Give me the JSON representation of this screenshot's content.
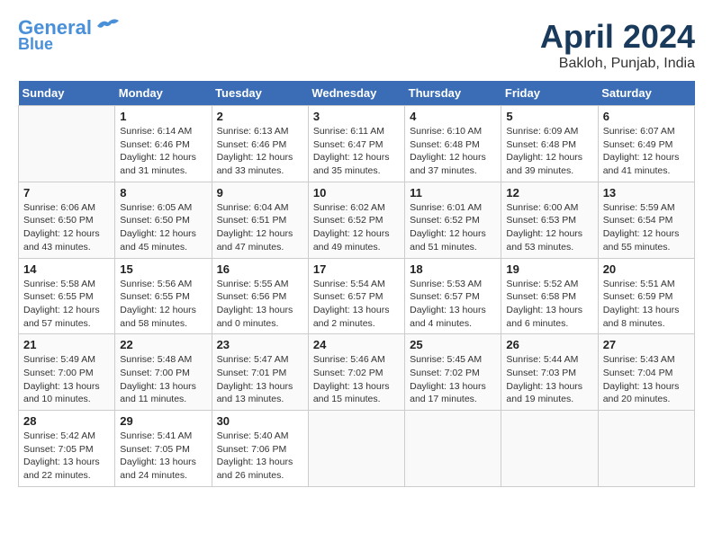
{
  "header": {
    "logo_line1": "General",
    "logo_line2": "Blue",
    "month_title": "April 2024",
    "location": "Bakloh, Punjab, India"
  },
  "weekdays": [
    "Sunday",
    "Monday",
    "Tuesday",
    "Wednesday",
    "Thursday",
    "Friday",
    "Saturday"
  ],
  "weeks": [
    [
      {
        "day": "",
        "info": ""
      },
      {
        "day": "1",
        "info": "Sunrise: 6:14 AM\nSunset: 6:46 PM\nDaylight: 12 hours\nand 31 minutes."
      },
      {
        "day": "2",
        "info": "Sunrise: 6:13 AM\nSunset: 6:46 PM\nDaylight: 12 hours\nand 33 minutes."
      },
      {
        "day": "3",
        "info": "Sunrise: 6:11 AM\nSunset: 6:47 PM\nDaylight: 12 hours\nand 35 minutes."
      },
      {
        "day": "4",
        "info": "Sunrise: 6:10 AM\nSunset: 6:48 PM\nDaylight: 12 hours\nand 37 minutes."
      },
      {
        "day": "5",
        "info": "Sunrise: 6:09 AM\nSunset: 6:48 PM\nDaylight: 12 hours\nand 39 minutes."
      },
      {
        "day": "6",
        "info": "Sunrise: 6:07 AM\nSunset: 6:49 PM\nDaylight: 12 hours\nand 41 minutes."
      }
    ],
    [
      {
        "day": "7",
        "info": "Sunrise: 6:06 AM\nSunset: 6:50 PM\nDaylight: 12 hours\nand 43 minutes."
      },
      {
        "day": "8",
        "info": "Sunrise: 6:05 AM\nSunset: 6:50 PM\nDaylight: 12 hours\nand 45 minutes."
      },
      {
        "day": "9",
        "info": "Sunrise: 6:04 AM\nSunset: 6:51 PM\nDaylight: 12 hours\nand 47 minutes."
      },
      {
        "day": "10",
        "info": "Sunrise: 6:02 AM\nSunset: 6:52 PM\nDaylight: 12 hours\nand 49 minutes."
      },
      {
        "day": "11",
        "info": "Sunrise: 6:01 AM\nSunset: 6:52 PM\nDaylight: 12 hours\nand 51 minutes."
      },
      {
        "day": "12",
        "info": "Sunrise: 6:00 AM\nSunset: 6:53 PM\nDaylight: 12 hours\nand 53 minutes."
      },
      {
        "day": "13",
        "info": "Sunrise: 5:59 AM\nSunset: 6:54 PM\nDaylight: 12 hours\nand 55 minutes."
      }
    ],
    [
      {
        "day": "14",
        "info": "Sunrise: 5:58 AM\nSunset: 6:55 PM\nDaylight: 12 hours\nand 57 minutes."
      },
      {
        "day": "15",
        "info": "Sunrise: 5:56 AM\nSunset: 6:55 PM\nDaylight: 12 hours\nand 58 minutes."
      },
      {
        "day": "16",
        "info": "Sunrise: 5:55 AM\nSunset: 6:56 PM\nDaylight: 13 hours\nand 0 minutes."
      },
      {
        "day": "17",
        "info": "Sunrise: 5:54 AM\nSunset: 6:57 PM\nDaylight: 13 hours\nand 2 minutes."
      },
      {
        "day": "18",
        "info": "Sunrise: 5:53 AM\nSunset: 6:57 PM\nDaylight: 13 hours\nand 4 minutes."
      },
      {
        "day": "19",
        "info": "Sunrise: 5:52 AM\nSunset: 6:58 PM\nDaylight: 13 hours\nand 6 minutes."
      },
      {
        "day": "20",
        "info": "Sunrise: 5:51 AM\nSunset: 6:59 PM\nDaylight: 13 hours\nand 8 minutes."
      }
    ],
    [
      {
        "day": "21",
        "info": "Sunrise: 5:49 AM\nSunset: 7:00 PM\nDaylight: 13 hours\nand 10 minutes."
      },
      {
        "day": "22",
        "info": "Sunrise: 5:48 AM\nSunset: 7:00 PM\nDaylight: 13 hours\nand 11 minutes."
      },
      {
        "day": "23",
        "info": "Sunrise: 5:47 AM\nSunset: 7:01 PM\nDaylight: 13 hours\nand 13 minutes."
      },
      {
        "day": "24",
        "info": "Sunrise: 5:46 AM\nSunset: 7:02 PM\nDaylight: 13 hours\nand 15 minutes."
      },
      {
        "day": "25",
        "info": "Sunrise: 5:45 AM\nSunset: 7:02 PM\nDaylight: 13 hours\nand 17 minutes."
      },
      {
        "day": "26",
        "info": "Sunrise: 5:44 AM\nSunset: 7:03 PM\nDaylight: 13 hours\nand 19 minutes."
      },
      {
        "day": "27",
        "info": "Sunrise: 5:43 AM\nSunset: 7:04 PM\nDaylight: 13 hours\nand 20 minutes."
      }
    ],
    [
      {
        "day": "28",
        "info": "Sunrise: 5:42 AM\nSunset: 7:05 PM\nDaylight: 13 hours\nand 22 minutes."
      },
      {
        "day": "29",
        "info": "Sunrise: 5:41 AM\nSunset: 7:05 PM\nDaylight: 13 hours\nand 24 minutes."
      },
      {
        "day": "30",
        "info": "Sunrise: 5:40 AM\nSunset: 7:06 PM\nDaylight: 13 hours\nand 26 minutes."
      },
      {
        "day": "",
        "info": ""
      },
      {
        "day": "",
        "info": ""
      },
      {
        "day": "",
        "info": ""
      },
      {
        "day": "",
        "info": ""
      }
    ]
  ]
}
